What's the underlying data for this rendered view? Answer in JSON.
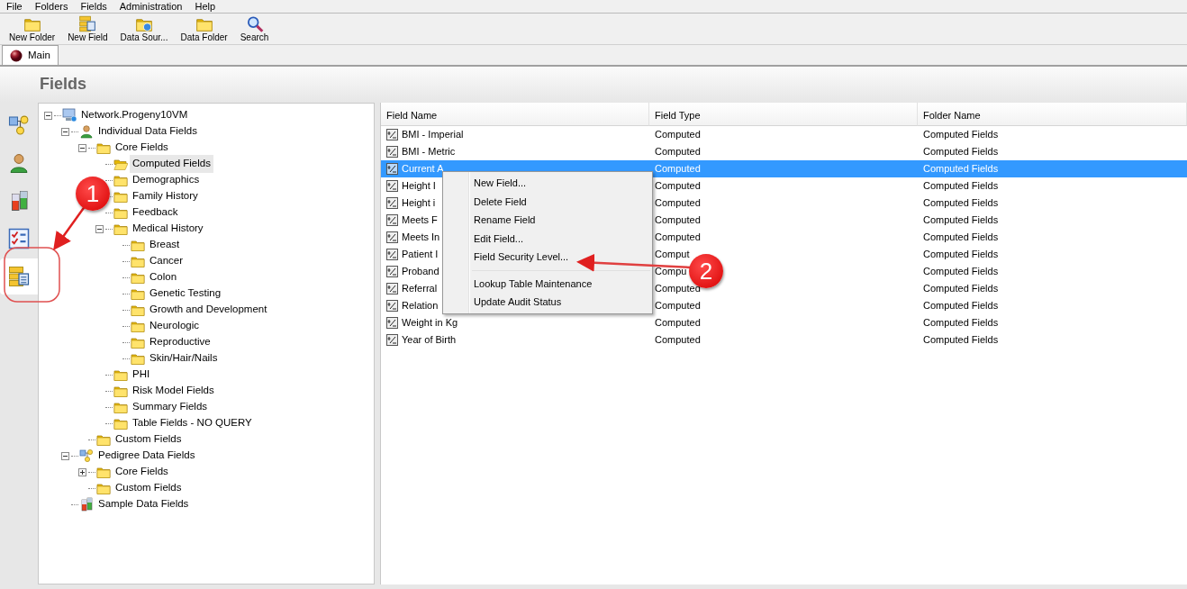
{
  "menu_bar": [
    "File",
    "Folders",
    "Fields",
    "Administration",
    "Help"
  ],
  "toolbar": [
    {
      "label": "New Folder",
      "kind": "folder"
    },
    {
      "label": "New Field",
      "kind": "field"
    },
    {
      "label": "Data Sour...",
      "kind": "datasource"
    },
    {
      "label": "Data Folder",
      "kind": "folder"
    },
    {
      "label": "Search",
      "kind": "search"
    }
  ],
  "tabs": [
    {
      "label": "Main",
      "selected": true
    }
  ],
  "page_title": "Fields",
  "sidebar": {
    "items": [
      {
        "kind": "pedigree",
        "selected": false
      },
      {
        "kind": "person",
        "selected": false
      },
      {
        "kind": "sample",
        "selected": false
      },
      {
        "kind": "checklist",
        "selected": false
      },
      {
        "kind": "fields",
        "selected": true
      }
    ]
  },
  "tree": [
    {
      "label": "Network.Progeny10VM",
      "kind": "computer",
      "expanded": true,
      "selected": false,
      "children": [
        {
          "label": "Individual Data Fields",
          "kind": "person",
          "expanded": true,
          "selected": false,
          "children": [
            {
              "label": "Core Fields",
              "kind": "folder",
              "expanded": true,
              "selected": false,
              "children": [
                {
                  "label": "Computed Fields",
                  "kind": "folder",
                  "selected": true
                },
                {
                  "label": "Demographics",
                  "kind": "folder",
                  "selected": false
                },
                {
                  "label": "Family History",
                  "kind": "folder",
                  "selected": false
                },
                {
                  "label": "Feedback",
                  "kind": "folder",
                  "selected": false
                },
                {
                  "label": "Medical History",
                  "kind": "folder",
                  "expanded": true,
                  "selected": false,
                  "children": [
                    {
                      "label": "Breast",
                      "kind": "folder",
                      "selected": false
                    },
                    {
                      "label": "Cancer",
                      "kind": "folder",
                      "selected": false
                    },
                    {
                      "label": "Colon",
                      "kind": "folder",
                      "selected": false
                    },
                    {
                      "label": "Genetic Testing",
                      "kind": "folder",
                      "selected": false
                    },
                    {
                      "label": "Growth and Development",
                      "kind": "folder",
                      "selected": false
                    },
                    {
                      "label": "Neurologic",
                      "kind": "folder",
                      "selected": false
                    },
                    {
                      "label": "Reproductive",
                      "kind": "folder",
                      "selected": false
                    },
                    {
                      "label": "Skin/Hair/Nails",
                      "kind": "folder",
                      "selected": false
                    }
                  ]
                },
                {
                  "label": "PHI",
                  "kind": "folder",
                  "selected": false
                },
                {
                  "label": "Risk Model Fields",
                  "kind": "folder",
                  "selected": false
                },
                {
                  "label": "Summary Fields",
                  "kind": "folder",
                  "selected": false
                },
                {
                  "label": "Table Fields - NO QUERY",
                  "kind": "folder",
                  "selected": false
                }
              ]
            },
            {
              "label": "Custom Fields",
              "kind": "folder",
              "selected": false
            }
          ]
        },
        {
          "label": "Pedigree Data Fields",
          "kind": "pedigree",
          "expanded": true,
          "selected": false,
          "children": [
            {
              "label": "Core Fields",
              "kind": "folder",
              "expanded": false,
              "selected": false
            },
            {
              "label": "Custom Fields",
              "kind": "folder",
              "selected": false
            }
          ]
        },
        {
          "label": "Sample Data Fields",
          "kind": "sample",
          "selected": false
        }
      ]
    }
  ],
  "table": {
    "columns": [
      "Field Name",
      "Field Type",
      "Folder Name"
    ],
    "rows": [
      {
        "cells": [
          "BMI - Imperial",
          "Computed",
          "Computed Fields"
        ],
        "selected": false
      },
      {
        "cells": [
          "BMI - Metric",
          "Computed",
          "Computed Fields"
        ],
        "selected": false
      },
      {
        "cells": [
          "Current A",
          "Computed",
          "Computed Fields"
        ],
        "selected": true
      },
      {
        "cells": [
          "Height I",
          "Computed",
          "Computed Fields"
        ],
        "selected": false
      },
      {
        "cells": [
          "Height i",
          "Computed",
          "Computed Fields"
        ],
        "selected": false
      },
      {
        "cells": [
          "Meets F",
          "Computed",
          "Computed Fields"
        ],
        "selected": false
      },
      {
        "cells": [
          "Meets In",
          "Computed",
          "Computed Fields"
        ],
        "selected": false
      },
      {
        "cells": [
          "Patient I",
          "Comput",
          "Computed Fields"
        ],
        "selected": false
      },
      {
        "cells": [
          "Proband",
          "Compu",
          "Computed Fields"
        ],
        "selected": false
      },
      {
        "cells": [
          "Referral",
          "Computed",
          "Computed Fields"
        ],
        "selected": false
      },
      {
        "cells": [
          "Relation",
          "Computed",
          "Computed Fields"
        ],
        "selected": false
      },
      {
        "cells": [
          "Weight in Kg",
          "Computed",
          "Computed Fields"
        ],
        "selected": false
      },
      {
        "cells": [
          "Year of Birth",
          "Computed",
          "Computed Fields"
        ],
        "selected": false
      }
    ]
  },
  "context_menu": {
    "groups": [
      [
        "New Field...",
        "Delete Field",
        "Rename Field",
        "Edit Field...",
        "Field Security Level..."
      ],
      [
        "Lookup Table Maintenance",
        "Update Audit Status"
      ]
    ]
  },
  "annotations": [
    {
      "label": "1"
    },
    {
      "label": "2"
    }
  ]
}
